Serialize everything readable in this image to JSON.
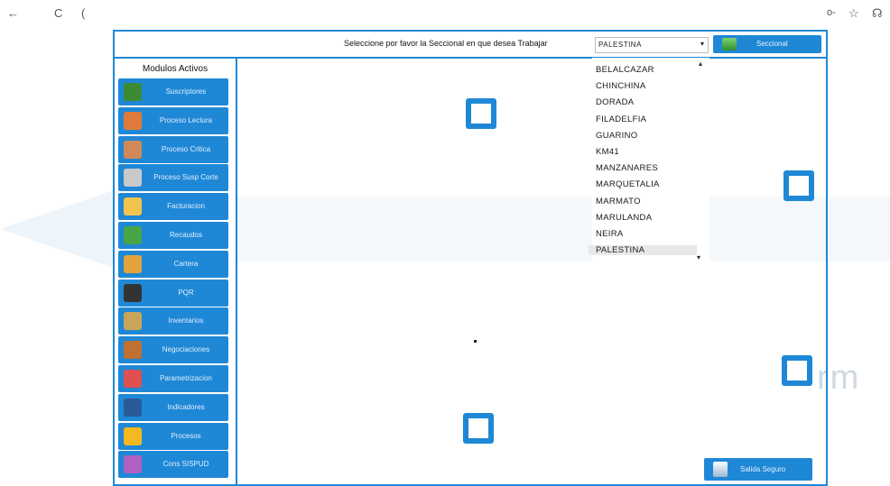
{
  "browser": {
    "back_icon": "←",
    "reload_icon": "C",
    "address_text": "(",
    "key_icon": "o-",
    "star_icon": "☆",
    "extension_icon": "☊"
  },
  "header": {
    "prompt": "Seleccione por favor la Seccional en que desea Trabajar",
    "select_value": "PALESTINA",
    "select_caret": "▾",
    "seccional_button_label": "Seccional"
  },
  "sidebar": {
    "title": "Modulos Activos",
    "items": [
      {
        "label": "Suscriptores",
        "icon": "users-icon",
        "color": "#3d8a34"
      },
      {
        "label": "Proceso Lectura",
        "icon": "pencil-icon",
        "color": "#e07a3a"
      },
      {
        "label": "Proceso Critica",
        "icon": "check-hand-icon",
        "color": "#d08a5a"
      },
      {
        "label": "Proceso Susp Corte",
        "icon": "scissors-icon",
        "color": "#c9c9c9"
      },
      {
        "label": "Facturacion",
        "icon": "invoice-icon",
        "color": "#f2c44e"
      },
      {
        "label": "Recaudos",
        "icon": "money-icon",
        "color": "#49a646"
      },
      {
        "label": "Cartera",
        "icon": "moneybag-icon",
        "color": "#e0a43a"
      },
      {
        "label": "PQR",
        "icon": "agent-icon",
        "color": "#333333"
      },
      {
        "label": "Inventarios",
        "icon": "boxes-icon",
        "color": "#c9a55a"
      },
      {
        "label": "Negociaciones",
        "icon": "briefcase-icon",
        "color": "#c07030"
      },
      {
        "label": "Parametrizacion",
        "icon": "tools-icon",
        "color": "#e05050"
      },
      {
        "label": "Indicadores",
        "icon": "chart-icon",
        "color": "#2a5a9a"
      },
      {
        "label": "Procesos",
        "icon": "gear-icon",
        "color": "#f5b820"
      },
      {
        "label": "Cons SISPUD",
        "icon": "database-icon",
        "color": "#b060c0"
      }
    ]
  },
  "dropdown": {
    "options": [
      "BELALCAZAR",
      "CHINCHINA",
      "DORADA",
      "FILADELFIA",
      "GUARINO",
      "KM41",
      "MANZANARES",
      "MARQUETALIA",
      "MARMATO",
      "MARULANDA",
      "NEIRA",
      "PALESTINA"
    ],
    "selected": "PALESTINA"
  },
  "bottom_button": {
    "label": "Salida Seguro"
  },
  "background_text": "rm",
  "colors": {
    "accent": "#1f88d6"
  }
}
